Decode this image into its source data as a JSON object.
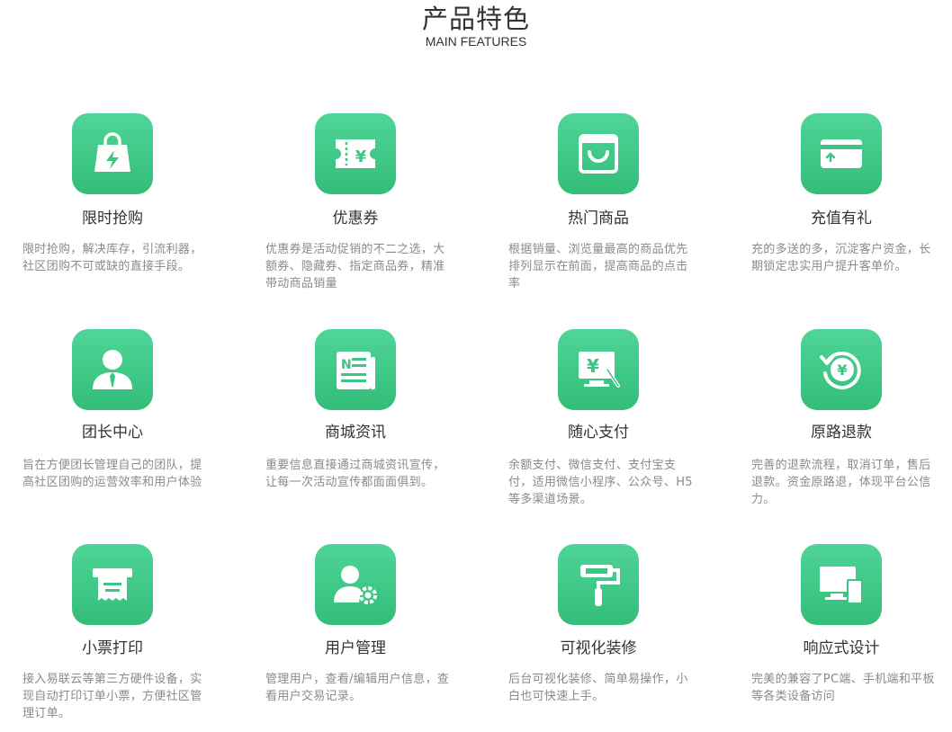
{
  "header": {
    "title": "产品特色",
    "subtitle": "MAIN FEATURES"
  },
  "accent": "#3cc583",
  "features": [
    {
      "icon": "shopping-bag-lightning-icon",
      "title": "限时抢购",
      "desc": "限时抢购，解决库存，引流利器，社区团购不可或缺的直接手段。"
    },
    {
      "icon": "coupon-icon",
      "title": "优惠券",
      "desc": "优惠券是活动促销的不二之选，大额券、隐藏券、指定商品券，精准带动商品销量"
    },
    {
      "icon": "shopping-basket-icon",
      "title": "热门商品",
      "desc": "根据销量、浏览量最高的商品优先排列显示在前面，提高商品的点击率"
    },
    {
      "icon": "credit-card-icon",
      "title": "充值有礼",
      "desc": "充的多送的多，沉淀客户资金，长期锁定忠实用户提升客单价。"
    },
    {
      "icon": "person-tie-icon",
      "title": "团长中心",
      "desc": "旨在方便团长管理自己的团队，提高社区团购的运营效率和用户体验"
    },
    {
      "icon": "newspaper-icon",
      "title": "商城资讯",
      "desc": "重要信息直接通过商城资讯宣传，让每一次活动宣传都面面俱到。"
    },
    {
      "icon": "payment-monitor-icon",
      "title": "随心支付",
      "desc": "余额支付、微信支付、支付宝支付，适用微信小程序、公众号、H5等多渠道场景。"
    },
    {
      "icon": "refund-icon",
      "title": "原路退款",
      "desc": "完善的退款流程，取消订单，售后退款。资金原路退，体现平台公信力。"
    },
    {
      "icon": "receipt-printer-icon",
      "title": "小票打印",
      "desc": "接入易联云等第三方硬件设备，实现自动打印订单小票，方便社区管理订单。"
    },
    {
      "icon": "user-gear-icon",
      "title": "用户管理",
      "desc": "管理用户，查看/编辑用户信息，查看用户交易记录。"
    },
    {
      "icon": "paint-roller-icon",
      "title": "可视化装修",
      "desc": "后台可视化装修、简单易操作，小白也可快速上手。"
    },
    {
      "icon": "responsive-devices-icon",
      "title": "响应式设计",
      "desc": "完美的兼容了PC端、手机端和平板等各类设备访问"
    }
  ]
}
